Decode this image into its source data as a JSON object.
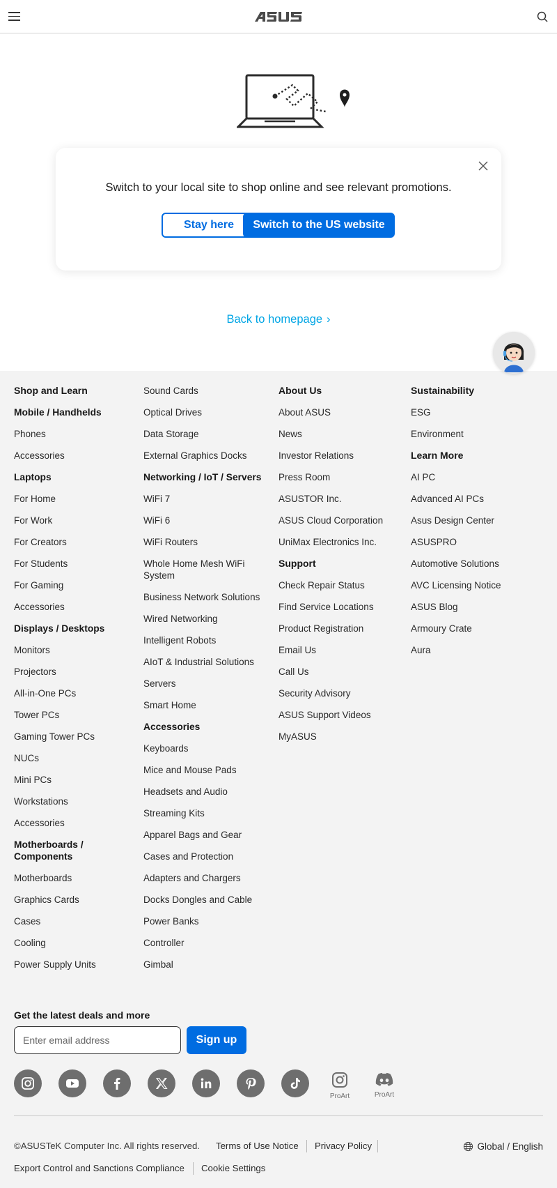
{
  "header": {
    "logo_text": "ASUS",
    "menu_icon": "hamburger-icon",
    "search_icon": "search-icon"
  },
  "modal": {
    "message": "Switch to your local site to shop online and see relevant promotions.",
    "stay_label": "Stay here",
    "switch_label": "Switch to the US website",
    "close_icon": "close-icon"
  },
  "back_home": "Back to homepage",
  "footer": {
    "columns": [
      {
        "items": [
          {
            "text": "Shop and Learn",
            "type": "top"
          },
          {
            "text": "Mobile / Handhelds",
            "type": "head"
          },
          {
            "text": "Phones",
            "type": "link"
          },
          {
            "text": "Accessories",
            "type": "link"
          },
          {
            "text": "Laptops",
            "type": "head"
          },
          {
            "text": "For Home",
            "type": "link"
          },
          {
            "text": "For Work",
            "type": "link"
          },
          {
            "text": "For Creators",
            "type": "link"
          },
          {
            "text": "For Students",
            "type": "link"
          },
          {
            "text": "For Gaming",
            "type": "link"
          },
          {
            "text": "Accessories",
            "type": "link"
          },
          {
            "text": "Displays / Desktops",
            "type": "head"
          },
          {
            "text": "Monitors",
            "type": "link"
          },
          {
            "text": "Projectors",
            "type": "link"
          },
          {
            "text": "All-in-One PCs",
            "type": "link"
          },
          {
            "text": "Tower PCs",
            "type": "link"
          },
          {
            "text": "Gaming Tower PCs",
            "type": "link"
          },
          {
            "text": "NUCs",
            "type": "link"
          },
          {
            "text": "Mini PCs",
            "type": "link"
          },
          {
            "text": "Workstations",
            "type": "link"
          },
          {
            "text": "Accessories",
            "type": "link"
          },
          {
            "text": "Motherboards / Components",
            "type": "head"
          },
          {
            "text": "Motherboards",
            "type": "link"
          },
          {
            "text": "Graphics Cards",
            "type": "link"
          },
          {
            "text": "Cases",
            "type": "link"
          },
          {
            "text": "Cooling",
            "type": "link"
          },
          {
            "text": "Power Supply Units",
            "type": "link"
          }
        ]
      },
      {
        "items": [
          {
            "text": "Sound Cards",
            "type": "link"
          },
          {
            "text": "Optical Drives",
            "type": "link"
          },
          {
            "text": "Data Storage",
            "type": "link"
          },
          {
            "text": "External Graphics Docks",
            "type": "link"
          },
          {
            "text": "Networking / IoT / Servers",
            "type": "head"
          },
          {
            "text": "WiFi 7",
            "type": "link"
          },
          {
            "text": "WiFi 6",
            "type": "link"
          },
          {
            "text": "WiFi Routers",
            "type": "link"
          },
          {
            "text": "Whole Home Mesh WiFi System",
            "type": "link"
          },
          {
            "text": "Business Network Solutions",
            "type": "link"
          },
          {
            "text": "Wired Networking",
            "type": "link"
          },
          {
            "text": "Intelligent Robots",
            "type": "link"
          },
          {
            "text": "AIoT & Industrial Solutions",
            "type": "link"
          },
          {
            "text": "Servers",
            "type": "link"
          },
          {
            "text": "Smart Home",
            "type": "link"
          },
          {
            "text": "Accessories",
            "type": "head"
          },
          {
            "text": "Keyboards",
            "type": "link"
          },
          {
            "text": "Mice and Mouse Pads",
            "type": "link"
          },
          {
            "text": "Headsets and Audio",
            "type": "link"
          },
          {
            "text": "Streaming Kits",
            "type": "link"
          },
          {
            "text": "Apparel Bags and Gear",
            "type": "link"
          },
          {
            "text": "Cases and Protection",
            "type": "link"
          },
          {
            "text": "Adapters and Chargers",
            "type": "link"
          },
          {
            "text": "Docks Dongles and Cable",
            "type": "link"
          },
          {
            "text": "Power Banks",
            "type": "link"
          },
          {
            "text": "Controller",
            "type": "link"
          },
          {
            "text": "Gimbal",
            "type": "link"
          }
        ]
      },
      {
        "items": [
          {
            "text": "About Us",
            "type": "top"
          },
          {
            "text": "About ASUS",
            "type": "link"
          },
          {
            "text": "News",
            "type": "link"
          },
          {
            "text": "Investor Relations",
            "type": "link"
          },
          {
            "text": "Press Room",
            "type": "link"
          },
          {
            "text": "ASUSTOR Inc.",
            "type": "link"
          },
          {
            "text": "ASUS Cloud Corporation",
            "type": "link"
          },
          {
            "text": "UniMax Electronics Inc.",
            "type": "link"
          },
          {
            "text": "Support",
            "type": "top"
          },
          {
            "text": "Check Repair Status",
            "type": "link"
          },
          {
            "text": "Find Service Locations",
            "type": "link"
          },
          {
            "text": "Product Registration",
            "type": "link"
          },
          {
            "text": "Email Us",
            "type": "link"
          },
          {
            "text": "Call Us",
            "type": "link"
          },
          {
            "text": "Security Advisory",
            "type": "link"
          },
          {
            "text": "ASUS Support Videos",
            "type": "link"
          },
          {
            "text": "MyASUS",
            "type": "link"
          }
        ]
      },
      {
        "items": [
          {
            "text": "Sustainability",
            "type": "top"
          },
          {
            "text": "ESG",
            "type": "link"
          },
          {
            "text": "Environment",
            "type": "link"
          },
          {
            "text": "Learn More",
            "type": "top"
          },
          {
            "text": "AI PC",
            "type": "link"
          },
          {
            "text": "Advanced AI PCs",
            "type": "link"
          },
          {
            "text": "Asus Design Center",
            "type": "link"
          },
          {
            "text": "ASUSPRO",
            "type": "link"
          },
          {
            "text": "Automotive Solutions",
            "type": "link"
          },
          {
            "text": "AVC Licensing Notice",
            "type": "link"
          },
          {
            "text": "ASUS Blog",
            "type": "link"
          },
          {
            "text": "Armoury Crate",
            "type": "link"
          },
          {
            "text": "Aura",
            "type": "link"
          }
        ]
      }
    ],
    "newsletter": {
      "title": "Get the latest deals and more",
      "placeholder": "Enter email address",
      "button": "Sign up"
    },
    "social": [
      {
        "icon": "instagram-icon"
      },
      {
        "icon": "youtube-icon"
      },
      {
        "icon": "facebook-icon"
      },
      {
        "icon": "x-icon"
      },
      {
        "icon": "linkedin-icon"
      },
      {
        "icon": "pinterest-icon"
      },
      {
        "icon": "tiktok-icon"
      },
      {
        "icon": "instagram-proart-icon",
        "label": "ProArt"
      },
      {
        "icon": "discord-proart-icon",
        "label": "ProArt"
      }
    ],
    "legal": {
      "copyright": "©ASUSTeK Computer Inc. All rights reserved.",
      "terms": "Terms of Use Notice",
      "privacy": "Privacy Policy",
      "export": "Export Control and Sanctions Compliance",
      "cookie": "Cookie Settings",
      "language": "Global / English"
    }
  },
  "colors": {
    "primary": "#006ce1",
    "link_blue": "#00a5e5",
    "footer_bg": "#f3f3f3"
  }
}
